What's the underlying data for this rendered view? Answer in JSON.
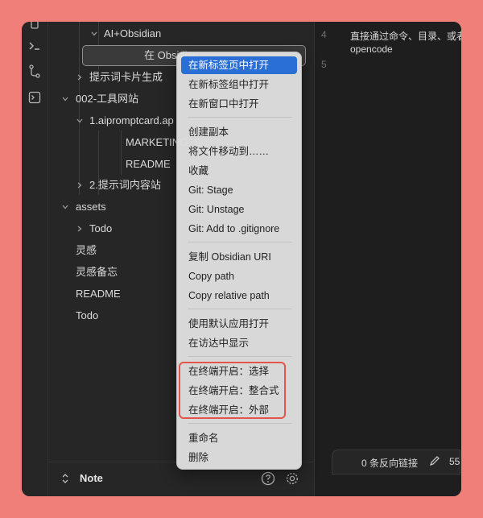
{
  "sidebar": {
    "items": [
      {
        "label": "AI+Obsidian"
      },
      {
        "label": "在 Obsidian"
      },
      {
        "label": "提示词卡片生成"
      },
      {
        "label": "002-工具网站"
      },
      {
        "label": "1.aipromptcard.ap"
      },
      {
        "label": "MARKETING_S"
      },
      {
        "label": "README"
      },
      {
        "label": "2.提示词内容站"
      },
      {
        "label": "assets"
      },
      {
        "label": "Todo"
      },
      {
        "label": "灵感"
      },
      {
        "label": "灵感备忘"
      },
      {
        "label": "README"
      },
      {
        "label": "Todo"
      }
    ],
    "footer": {
      "vault_name": "Note"
    }
  },
  "editor": {
    "lines": [
      {
        "num": "4",
        "text": "直接通过命令、目录、或者"
      },
      {
        "num": "",
        "text": "opencode"
      },
      {
        "num": "5",
        "text": ""
      }
    ]
  },
  "status": {
    "backlinks": "0 条反向链接",
    "count": "55"
  },
  "menu": {
    "items": [
      "在新标签页中打开",
      "在新标签组中打开",
      "在新窗口中打开",
      "创建副本",
      "将文件移动到……",
      "收藏",
      "Git: Stage",
      "Git: Unstage",
      "Git: Add to .gitignore",
      "复制 Obsidian URI",
      "Copy path",
      "Copy relative path",
      "使用默认应用打开",
      "在访达中显示",
      "在终端开启：选择",
      "在终端开启：整合式",
      "在终端开启：外部",
      "重命名",
      "删除"
    ]
  },
  "colors": {
    "accent": "#2a6fd6",
    "highlight_box": "#e5544a",
    "background": "#f07f79"
  }
}
